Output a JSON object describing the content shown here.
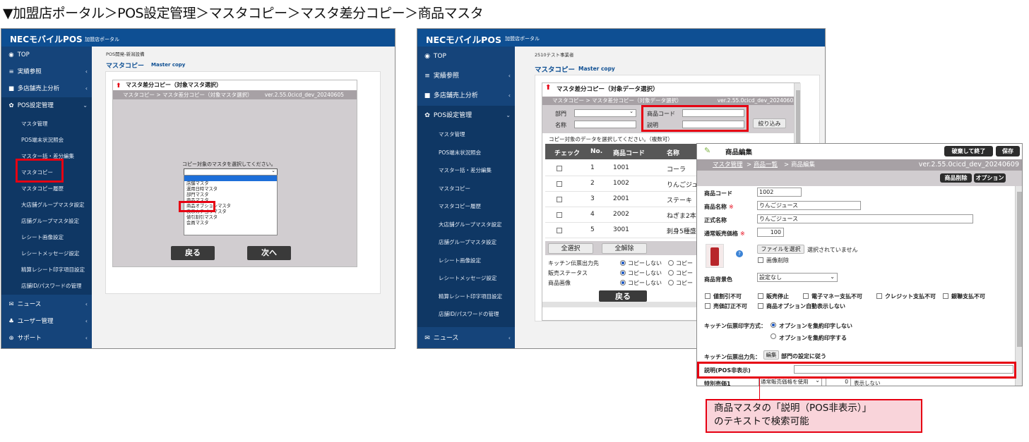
{
  "headline": "▼加盟店ポータル＞POS設定管理＞マスタコピー＞マスタ差分コピー＞商品マスタ",
  "screen1": {
    "brand": "NECモバイルPOS",
    "brand_sub": "加盟店ポータル",
    "store_label": "POS開発-新潟設備",
    "page_title": "マスタコピー",
    "page_title_en": "Master copy",
    "sidebar": [
      {
        "icon": "◉",
        "label": "TOP",
        "chevron": ""
      },
      {
        "icon": "≡",
        "label": "実績参照",
        "chevron": "‹"
      },
      {
        "icon": "■",
        "label": "多店舗売上分析",
        "chevron": "‹"
      },
      {
        "icon": "✿",
        "label": "POS設定管理",
        "chevron": "⌄"
      }
    ],
    "sub_items": [
      "マスタ管理",
      "POS端末状況照会",
      "マスター括・差分編集",
      "マスタコピー",
      "マスタコピー履歴",
      "大店舗グループマスタ設定",
      "店舗グループマスタ設定",
      "レシート画像設定",
      "レシートメッセージ設定",
      "精算レシート印字項目設定",
      "店舗ID/パスワードの管理"
    ],
    "bottom_items": [
      {
        "icon": "✉",
        "label": "ニュース",
        "chevron": "‹"
      },
      {
        "icon": "♣",
        "label": "ユーザー管理",
        "chevron": "‹"
      },
      {
        "icon": "⊕",
        "label": "サポート",
        "chevron": "‹"
      }
    ],
    "dialog": {
      "title": "マスタ差分コピー（対象マスタ選択）",
      "crumb": "マスタコピー > マスタ差分コピー（対象マスタ選択）",
      "version": "ver.2.55.0cicd_dev_20240605",
      "prompt": "コピー対象のマスタを選択してください。",
      "options": [
        "",
        "店舗マスタ",
        "運用日時マスタ",
        "部門マスタ",
        "商品マスタ",
        "商品オプションマスタ",
        "表示カテゴリマスタ",
        "値引割引マスタ",
        "会員マスタ"
      ],
      "selected_index": 0,
      "back_label": "戻る",
      "next_label": "次へ"
    }
  },
  "screen2": {
    "brand": "NECモバイルPOS",
    "brand_sub": "加盟店ポータル",
    "store_label": "2510テスト事業者",
    "page_title": "マスタコピー",
    "page_title_en": "Master copy",
    "sidebar": [
      {
        "icon": "◉",
        "label": "TOP",
        "chevron": ""
      },
      {
        "icon": "≡",
        "label": "実績参照",
        "chevron": "‹"
      },
      {
        "icon": "■",
        "label": "多店舗売上分析",
        "chevron": "‹"
      },
      {
        "icon": "✿",
        "label": "POS設定管理",
        "chevron": "⌄"
      }
    ],
    "sub_items": [
      "マスタ管理",
      "POS端末状況照会",
      "マスター括・差分編集",
      "マスタコピー",
      "マスタコピー履歴",
      "大店舗グループマスタ設定",
      "店舗グループマスタ設定",
      "レシート画像設定",
      "レシートメッセージ設定",
      "精算レシート印字項目設定",
      "店舗ID/パスワードの管理"
    ],
    "bottom_items": [
      {
        "icon": "✉",
        "label": "ニュース",
        "chevron": "‹"
      }
    ],
    "dialog": {
      "title": "マスタ差分コピー（対象データ選択）",
      "crumb": "マスタコピー > マスタ差分コピー（対象データ選択）",
      "version": "ver.2.55.0cicd_dev_20240605",
      "dept_label": "部門",
      "name_label": "名称",
      "code_label": "商品コード",
      "desc_label": "説明",
      "filter_label": "絞り込み",
      "instruction": "コピー対象のデータを選択してください。（複数可）",
      "columns": [
        "チェック",
        "No.",
        "商品コード",
        "名称"
      ],
      "rows": [
        {
          "no": "1",
          "code": "1001",
          "name": "コーラ"
        },
        {
          "no": "2",
          "code": "1002",
          "name": "りんごジュ"
        },
        {
          "no": "3",
          "code": "2001",
          "name": "ステーキ"
        },
        {
          "no": "4",
          "code": "2002",
          "name": "ねぎま2本"
        },
        {
          "no": "5",
          "code": "3001",
          "name": "刺身5種盛"
        }
      ],
      "select_all": "全選択",
      "clear_all": "全解除",
      "options": [
        {
          "label": "キッチン伝票出力先",
          "value": "コピーしない",
          "alt": "コピー"
        },
        {
          "label": "販売ステータス",
          "value": "コピーしない",
          "alt": "コピー"
        },
        {
          "label": "商品画像",
          "value": "コピーしない",
          "alt": "コピー"
        }
      ],
      "back_label": "戻る"
    }
  },
  "screen3": {
    "title": "商品編集",
    "discard_label": "破棄して終了",
    "save_label": "保存",
    "crumb_1": "マスタ管理",
    "crumb_2": "商品一覧",
    "crumb_3": "商品編集",
    "version": "ver.2.55.0cicd_dev_20240609",
    "delete_label": "商品削除",
    "option_label": "オプション",
    "fields": {
      "code_label": "商品コード",
      "code_value": "1002",
      "name_label": "商品名称",
      "name_value": "りんごジュース",
      "formal_label": "正式名称",
      "formal_value": "りんごジュース",
      "price_label": "通常販売価格",
      "price_value": "100",
      "file_button": "ファイルを選択",
      "file_status": "選択されていません",
      "image_delete": "画像削除",
      "bg_label": "商品背景色",
      "bg_value": "設定なし",
      "checks": [
        "値割引不可",
        "販売停止",
        "電子マネー支払不可",
        "クレジット支払不可",
        "銀聯支払不可",
        "売価訂正不可",
        "商品オプション自動表示しない"
      ],
      "kitchen_mode_label": "キッチン伝票印字方式：",
      "kitchen_mode_1": "オプションを集約印字しない",
      "kitchen_mode_2": "オプションを集約印字する",
      "kitchen_out_label": "キッチン伝票出力先：",
      "kitchen_out_btn": "編集",
      "kitchen_out_value": "部門の設定に従う",
      "desc_label": "説明(POS非表示)",
      "desc_value": "",
      "special_label": "特別売価1",
      "special_select": "通常販売価格を使用",
      "special_value": "0",
      "special_note": "表示しない",
      "required_mark": "※"
    }
  },
  "callout": {
    "line1": "商品マスタの「説明（POS非表示）」",
    "line2": "のテキストで検索可能"
  },
  "colors": {
    "header_blue": "#0e4f93",
    "sidebar_blue": "#15447a",
    "highlight_red": "#e60012",
    "callout_pink": "#f9d4da"
  }
}
